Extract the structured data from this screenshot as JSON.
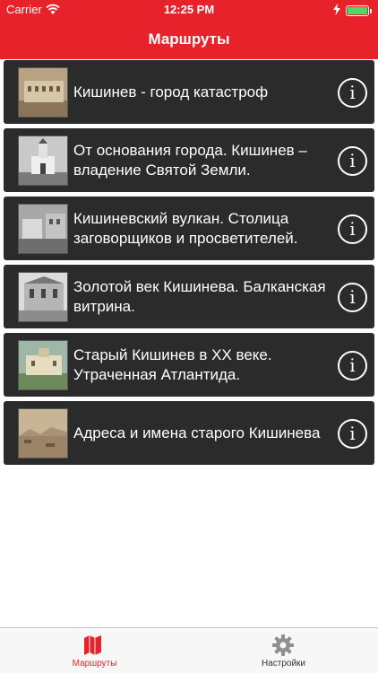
{
  "status_bar": {
    "carrier": "Carrier",
    "time": "12:25 PM",
    "battery_level": 1.0
  },
  "nav": {
    "title": "Маршруты"
  },
  "routes": [
    {
      "title": "Кишинев - город катастроф",
      "thumbnail": "sepia-photo"
    },
    {
      "title": "От основания города. Кишинев – владение Святой Земли.",
      "thumbnail": "bw-church-photo"
    },
    {
      "title": "Кишиневский вулкан. Столица заговорщиков и просветителей.",
      "thumbnail": "bw-street-photo"
    },
    {
      "title": "Золотой век Кишинева. Балканская витрина.",
      "thumbnail": "bw-building-photo"
    },
    {
      "title": "Старый Кишинев в XX веке. Утраченная Атлантида.",
      "thumbnail": "color-postcard"
    },
    {
      "title": "Адреса и имена старого Кишинева",
      "thumbnail": "sepia-landscape"
    }
  ],
  "info_glyph": "i",
  "tabs": [
    {
      "label": "Маршруты",
      "icon": "map-icon",
      "active": true
    },
    {
      "label": "Настройки",
      "icon": "gear-icon",
      "active": false
    }
  ],
  "colors": {
    "accent": "#e8222b",
    "card_bg": "#2b2b2b",
    "tab_inactive": "#8e8e93"
  }
}
